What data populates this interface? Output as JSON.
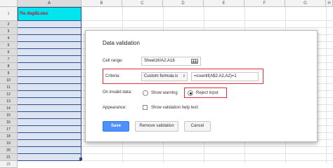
{
  "spreadsheet": {
    "columns": [
      "A",
      "B",
      "C",
      "D",
      "E",
      "F",
      "G",
      "H"
    ],
    "rows": [
      "1",
      "2",
      "3",
      "4",
      "5",
      "6",
      "7",
      "8",
      "9",
      "10",
      "11",
      "12",
      "13",
      "14",
      "15",
      "16",
      "17",
      "18",
      "19",
      "20",
      "21",
      "22"
    ],
    "cell_a1": "No duplicates",
    "header_color": "#00e5ee",
    "header_text_color": "#c0143c",
    "selection_color": "#dde4f1"
  },
  "dialog": {
    "title": "Data validation",
    "cell_range_label": "Cell range:",
    "cell_range_value": "Sheet16!A2:A18",
    "criteria_label": "Criteria:",
    "criteria_type": "Custom formula is",
    "criteria_formula": "=countif(A$2:A2,A2)=1",
    "invalid_label": "On invalid data:",
    "show_warning_label": "Show warning",
    "reject_input_label": "Reject input",
    "appearance_label": "Appearance:",
    "help_text_label": "Show validation help text:",
    "save_label": "Save",
    "remove_label": "Remove validation",
    "cancel_label": "Cancel",
    "highlight_color": "#e0303e",
    "primary_color": "#4d90fe"
  }
}
